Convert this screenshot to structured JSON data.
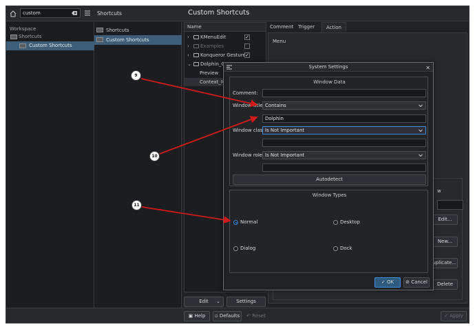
{
  "topbar": {
    "search_value": "custom",
    "breadcrumb": "Shortcuts",
    "page_title": "Custom Shortcuts"
  },
  "sidebar": {
    "heading": "Workspace",
    "items": [
      {
        "label": "Shortcuts"
      },
      {
        "label": "Custom Shortcuts"
      }
    ]
  },
  "list": {
    "items": [
      {
        "label": "Shortcuts"
      },
      {
        "label": "Custom Shortcuts"
      }
    ]
  },
  "tree": {
    "header": "Name",
    "rows": [
      {
        "label": "KMenuEdit",
        "checked": true
      },
      {
        "label": "Examples",
        "checked": false
      },
      {
        "label": "Konqueror Gestures",
        "checked": true
      },
      {
        "label": "Dolphin_Custom",
        "checked": true
      },
      {
        "label": "Preview"
      },
      {
        "label": "Context_Menu"
      }
    ]
  },
  "tabs": {
    "items": [
      {
        "label": "Comment"
      },
      {
        "label": "Trigger"
      },
      {
        "label": "Action"
      }
    ],
    "action_menu_label": "Menu"
  },
  "right_buttons": {
    "edit": "Edit...",
    "new": "New...",
    "duplicate": "Duplicate...",
    "delete": "Delete",
    "partial_text": "w"
  },
  "tree_buttons": {
    "edit": "Edit",
    "settings": "Settings"
  },
  "bottombar": {
    "help": "Help",
    "defaults": "Defaults",
    "reset": "Reset",
    "apply": "Apply"
  },
  "dialog": {
    "title": "System Settings",
    "window_data": {
      "heading": "Window Data",
      "comment_label": "Comment:",
      "comment_value": "",
      "window_title_label": "Window title:",
      "window_title_mode": "Contains",
      "window_title_value": "Dolphin",
      "window_class_label": "Window class:",
      "window_class_mode": "Is Not Important",
      "window_class_value": "",
      "window_role_label": "Window role:",
      "window_role_mode": "Is Not Important",
      "window_role_value": "",
      "autodetect": "Autodetect"
    },
    "window_types": {
      "heading": "Window Types",
      "options": [
        {
          "label": "Normal",
          "selected": true
        },
        {
          "label": "Desktop",
          "selected": false
        },
        {
          "label": "Dialog",
          "selected": false
        },
        {
          "label": "Dock",
          "selected": false
        }
      ]
    },
    "ok": "OK",
    "cancel": "Cancel"
  },
  "annotations": {
    "callouts": [
      "9",
      "10",
      "11"
    ],
    "arrow_color": "#d11a1a"
  },
  "colors": {
    "accent": "#3d8ee0",
    "selection": "#3d5d78",
    "background": "#1f2124"
  }
}
